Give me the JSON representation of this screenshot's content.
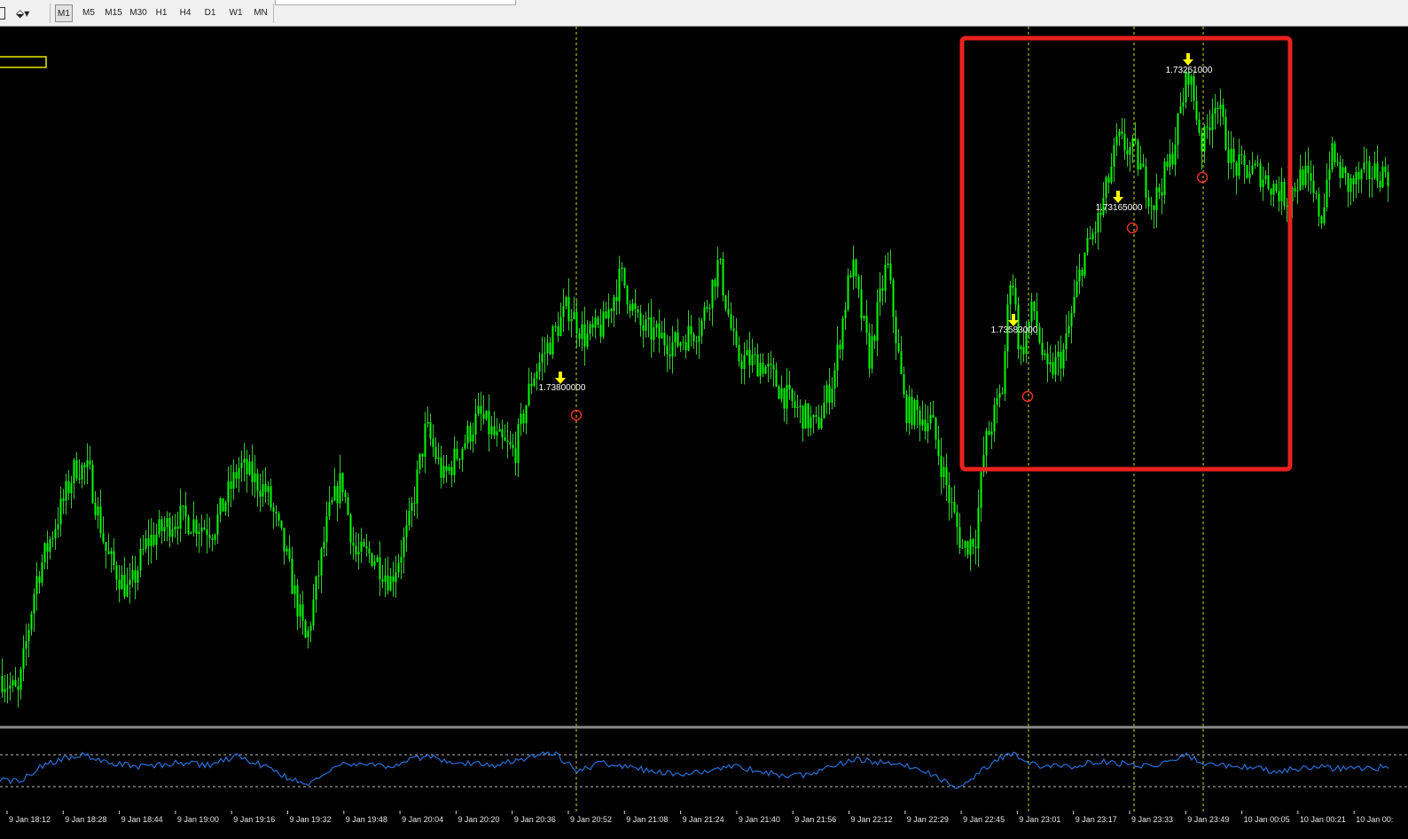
{
  "toolbar": {
    "timeframes": [
      "M1",
      "M5",
      "M15",
      "M30",
      "H1",
      "H4",
      "D1",
      "W1",
      "MN"
    ],
    "active_timeframe": "M1"
  },
  "colors": {
    "background": "#000000",
    "candle": "#00ff00",
    "wick": "#33cc33",
    "signal_arrow": "#ffff00",
    "signal_label": "#ffffff",
    "signal_circle": "#ff3030",
    "vline": "#d7d700",
    "indicator": "#2a6fd6",
    "indicator_levels": "#bdbdbd",
    "highlight_box": "#e8221e"
  },
  "chart_data": {
    "type": "candlestick",
    "x_tick_labels": [
      "9 Jan 18:12",
      "9 Jan 18:28",
      "9 Jan 18:44",
      "9 Jan 19:00",
      "9 Jan 19:16",
      "9 Jan 19:32",
      "9 Jan 19:48",
      "9 Jan 20:04",
      "9 Jan 20:20",
      "9 Jan 20:36",
      "9 Jan 20:52",
      "9 Jan 21:08",
      "9 Jan 21:24",
      "9 Jan 21:40",
      "9 Jan 21:56",
      "9 Jan 22:12",
      "9 Jan 22:29",
      "9 Jan 22:45",
      "9 Jan 23:01",
      "9 Jan 23:17",
      "9 Jan 23:33",
      "9 Jan 23:49",
      "10 Jan 00:05",
      "10 Jan 00:21",
      "10 Jan 00:"
    ],
    "price_profile": [
      [
        0,
        0.05
      ],
      [
        20,
        0.02
      ],
      [
        40,
        0.2
      ],
      [
        60,
        0.28
      ],
      [
        85,
        0.38
      ],
      [
        100,
        0.37
      ],
      [
        120,
        0.24
      ],
      [
        145,
        0.18
      ],
      [
        165,
        0.26
      ],
      [
        200,
        0.3
      ],
      [
        240,
        0.28
      ],
      [
        270,
        0.38
      ],
      [
        300,
        0.34
      ],
      [
        320,
        0.25
      ],
      [
        345,
        0.1
      ],
      [
        370,
        0.3
      ],
      [
        385,
        0.36
      ],
      [
        400,
        0.24
      ],
      [
        420,
        0.24
      ],
      [
        440,
        0.2
      ],
      [
        460,
        0.28
      ],
      [
        480,
        0.44
      ],
      [
        500,
        0.36
      ],
      [
        540,
        0.46
      ],
      [
        560,
        0.42
      ],
      [
        580,
        0.4
      ],
      [
        600,
        0.52
      ],
      [
        640,
        0.63
      ],
      [
        660,
        0.58
      ],
      [
        680,
        0.6
      ],
      [
        700,
        0.68
      ],
      [
        720,
        0.6
      ],
      [
        760,
        0.57
      ],
      [
        790,
        0.6
      ],
      [
        810,
        0.7
      ],
      [
        830,
        0.55
      ],
      [
        860,
        0.54
      ],
      [
        890,
        0.48
      ],
      [
        920,
        0.44
      ],
      [
        940,
        0.52
      ],
      [
        960,
        0.7
      ],
      [
        980,
        0.55
      ],
      [
        1000,
        0.7
      ],
      [
        1020,
        0.47
      ],
      [
        1050,
        0.45
      ],
      [
        1070,
        0.33
      ],
      [
        1085,
        0.25
      ],
      [
        1100,
        0.27
      ],
      [
        1110,
        0.41
      ],
      [
        1130,
        0.5
      ],
      [
        1140,
        0.7
      ],
      [
        1150,
        0.55
      ],
      [
        1165,
        0.63
      ],
      [
        1180,
        0.52
      ],
      [
        1200,
        0.56
      ],
      [
        1220,
        0.7
      ],
      [
        1240,
        0.77
      ],
      [
        1260,
        0.89
      ],
      [
        1280,
        0.87
      ],
      [
        1300,
        0.79
      ],
      [
        1320,
        0.86
      ],
      [
        1340,
        1.0
      ],
      [
        1356,
        0.88
      ],
      [
        1370,
        0.96
      ],
      [
        1390,
        0.85
      ],
      [
        1420,
        0.84
      ],
      [
        1450,
        0.8
      ],
      [
        1470,
        0.84
      ],
      [
        1490,
        0.77
      ],
      [
        1500,
        0.87
      ],
      [
        1520,
        0.82
      ],
      [
        1545,
        0.84
      ],
      [
        1568,
        0.84
      ]
    ],
    "signals": [
      {
        "label": "1.73800000"
      },
      {
        "label": "1.73583000"
      },
      {
        "label": "1.73165000"
      },
      {
        "label": "1.73251000"
      }
    ],
    "indicator": {
      "levels": [
        "upper",
        "lower"
      ],
      "profile": [
        [
          0,
          -0.4
        ],
        [
          20,
          -0.6
        ],
        [
          45,
          0.2
        ],
        [
          90,
          0.9
        ],
        [
          120,
          0.4
        ],
        [
          160,
          0.2
        ],
        [
          200,
          0.4
        ],
        [
          240,
          0.3
        ],
        [
          265,
          0.8
        ],
        [
          300,
          0.2
        ],
        [
          345,
          -0.8
        ],
        [
          380,
          0.3
        ],
        [
          410,
          0.4
        ],
        [
          440,
          0.2
        ],
        [
          480,
          0.8
        ],
        [
          520,
          0.4
        ],
        [
          560,
          0.3
        ],
        [
          600,
          0.8
        ],
        [
          625,
          1.0
        ],
        [
          650,
          0.0
        ],
        [
          680,
          0.4
        ],
        [
          720,
          0.1
        ],
        [
          760,
          -0.2
        ],
        [
          800,
          0.0
        ],
        [
          830,
          0.3
        ],
        [
          860,
          -0.1
        ],
        [
          900,
          -0.3
        ],
        [
          940,
          0.2
        ],
        [
          960,
          0.6
        ],
        [
          1000,
          0.4
        ],
        [
          1040,
          0.1
        ],
        [
          1075,
          -0.9
        ],
        [
          1095,
          -0.5
        ],
        [
          1120,
          0.5
        ],
        [
          1140,
          0.9
        ],
        [
          1165,
          0.3
        ],
        [
          1200,
          0.2
        ],
        [
          1240,
          0.5
        ],
        [
          1280,
          0.3
        ],
        [
          1300,
          0.3
        ],
        [
          1340,
          0.8
        ],
        [
          1360,
          0.3
        ],
        [
          1400,
          0.2
        ],
        [
          1440,
          0.0
        ],
        [
          1480,
          0.2
        ],
        [
          1520,
          0.1
        ],
        [
          1568,
          0.2
        ]
      ]
    }
  }
}
